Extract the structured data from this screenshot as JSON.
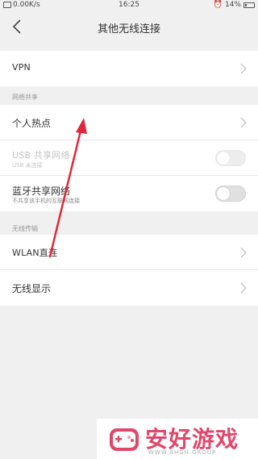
{
  "status_bar": {
    "left_text": "0.00K/s",
    "time": "16:25",
    "battery": "14%"
  },
  "header": {
    "title": "其他无线连接"
  },
  "vpn_section": {
    "vpn_label": "VPN"
  },
  "sharing_section": {
    "header": "网络共享",
    "hotspot_label": "个人热点",
    "usb_label": "USB 共享网络",
    "usb_sub": "USB 未连接",
    "bt_label": "蓝牙共享网络",
    "bt_sub": "不共享该手机的互联网连接"
  },
  "wireless_section": {
    "header": "无线传输",
    "wlan_direct_label": "WLAN直连",
    "wireless_display_label": "无线显示"
  },
  "watermark": {
    "name": "安好游戏",
    "sub": "WWW.AHGH.GROUP"
  },
  "colors": {
    "annotation_arrow": "#e0283a",
    "brand": "#e0486b"
  }
}
